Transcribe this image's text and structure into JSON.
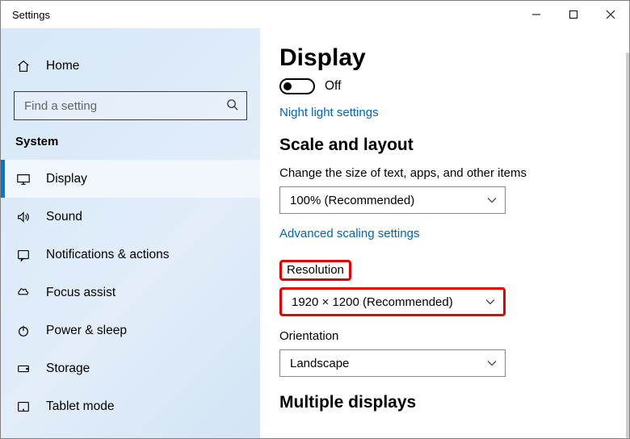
{
  "window": {
    "title": "Settings"
  },
  "home_label": "Home",
  "search": {
    "placeholder": "Find a setting"
  },
  "group": "System",
  "nav": [
    {
      "key": "display",
      "label": "Display",
      "selected": true
    },
    {
      "key": "sound",
      "label": "Sound",
      "selected": false
    },
    {
      "key": "notifications",
      "label": "Notifications & actions",
      "selected": false
    },
    {
      "key": "focus-assist",
      "label": "Focus assist",
      "selected": false
    },
    {
      "key": "power-sleep",
      "label": "Power & sleep",
      "selected": false
    },
    {
      "key": "storage",
      "label": "Storage",
      "selected": false
    },
    {
      "key": "tablet-mode",
      "label": "Tablet mode",
      "selected": false
    }
  ],
  "display": {
    "title": "Display",
    "night_light_toggle": {
      "state": "Off"
    },
    "night_light_link": "Night light settings",
    "scale_heading": "Scale and layout",
    "scale_label": "Change the size of text, apps, and other items",
    "scale_value": "100% (Recommended)",
    "advanced_scaling_link": "Advanced scaling settings",
    "resolution_label": "Resolution",
    "resolution_value": "1920 × 1200 (Recommended)",
    "orientation_label": "Orientation",
    "orientation_value": "Landscape",
    "multiple_displays_heading": "Multiple displays"
  }
}
